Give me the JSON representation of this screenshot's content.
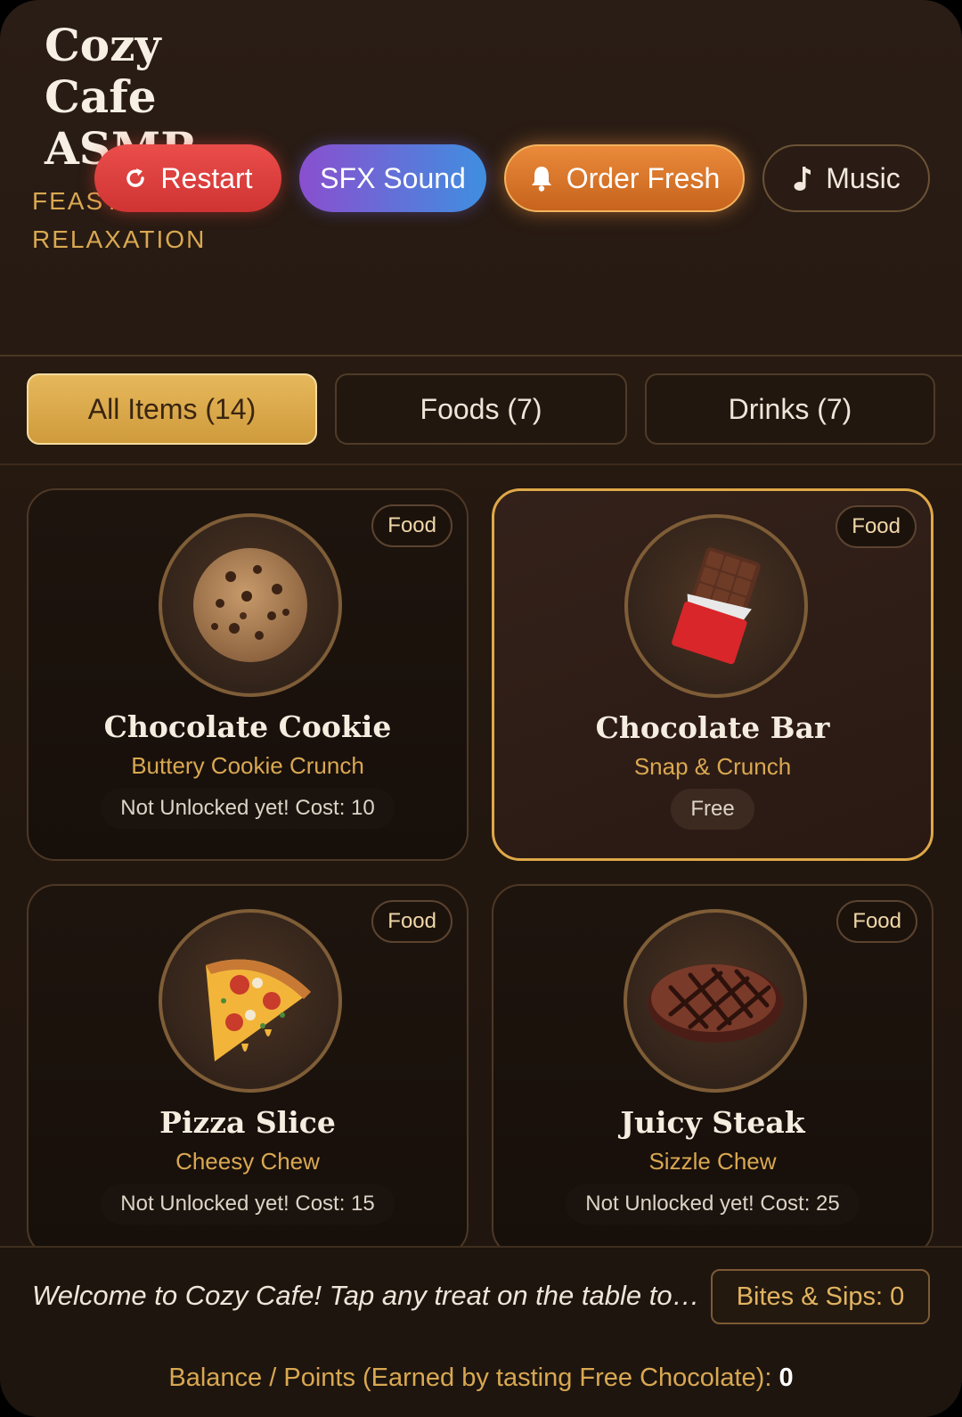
{
  "header": {
    "title": "Cozy Cafe ASMR",
    "subtitle": "FEAST & SIP RELAXATION",
    "buttons": {
      "restart": "Restart",
      "sfx": "SFX Sound",
      "order": "Order Fresh",
      "music": "Music"
    }
  },
  "tabs": [
    {
      "label": "All Items (14)",
      "active": true
    },
    {
      "label": "Foods (7)",
      "active": false
    },
    {
      "label": "Drinks (7)",
      "active": false
    }
  ],
  "items": [
    {
      "name": "Chocolate Cookie",
      "subtitle": "Buttery Cookie Crunch",
      "badge": "Food",
      "status": "Not Unlocked yet! Cost: 10",
      "icon": "cookie-icon",
      "selected": false
    },
    {
      "name": "Chocolate Bar",
      "subtitle": "Snap & Crunch",
      "badge": "Food",
      "status": "Free",
      "icon": "chocolate-bar-icon",
      "selected": true
    },
    {
      "name": "Pizza Slice",
      "subtitle": "Cheesy Chew",
      "badge": "Food",
      "status": "Not Unlocked yet! Cost: 15",
      "icon": "pizza-icon",
      "selected": false
    },
    {
      "name": "Juicy Steak",
      "subtitle": "Sizzle Chew",
      "badge": "Food",
      "status": "Not Unlocked yet! Cost: 25",
      "icon": "steak-icon",
      "selected": false
    }
  ],
  "footer": {
    "welcome": "Welcome to Cozy Cafe! Tap any treat on the table to taste it",
    "counter": "Bites & Sips: 0",
    "balance_label": "Balance / Points (Earned by tasting Free Chocolate):",
    "balance_value": "0"
  },
  "colors": {
    "accent_gold": "#d9a851",
    "restart_red": "#e04642",
    "order_orange": "#e07f32",
    "background": "#24180f"
  }
}
